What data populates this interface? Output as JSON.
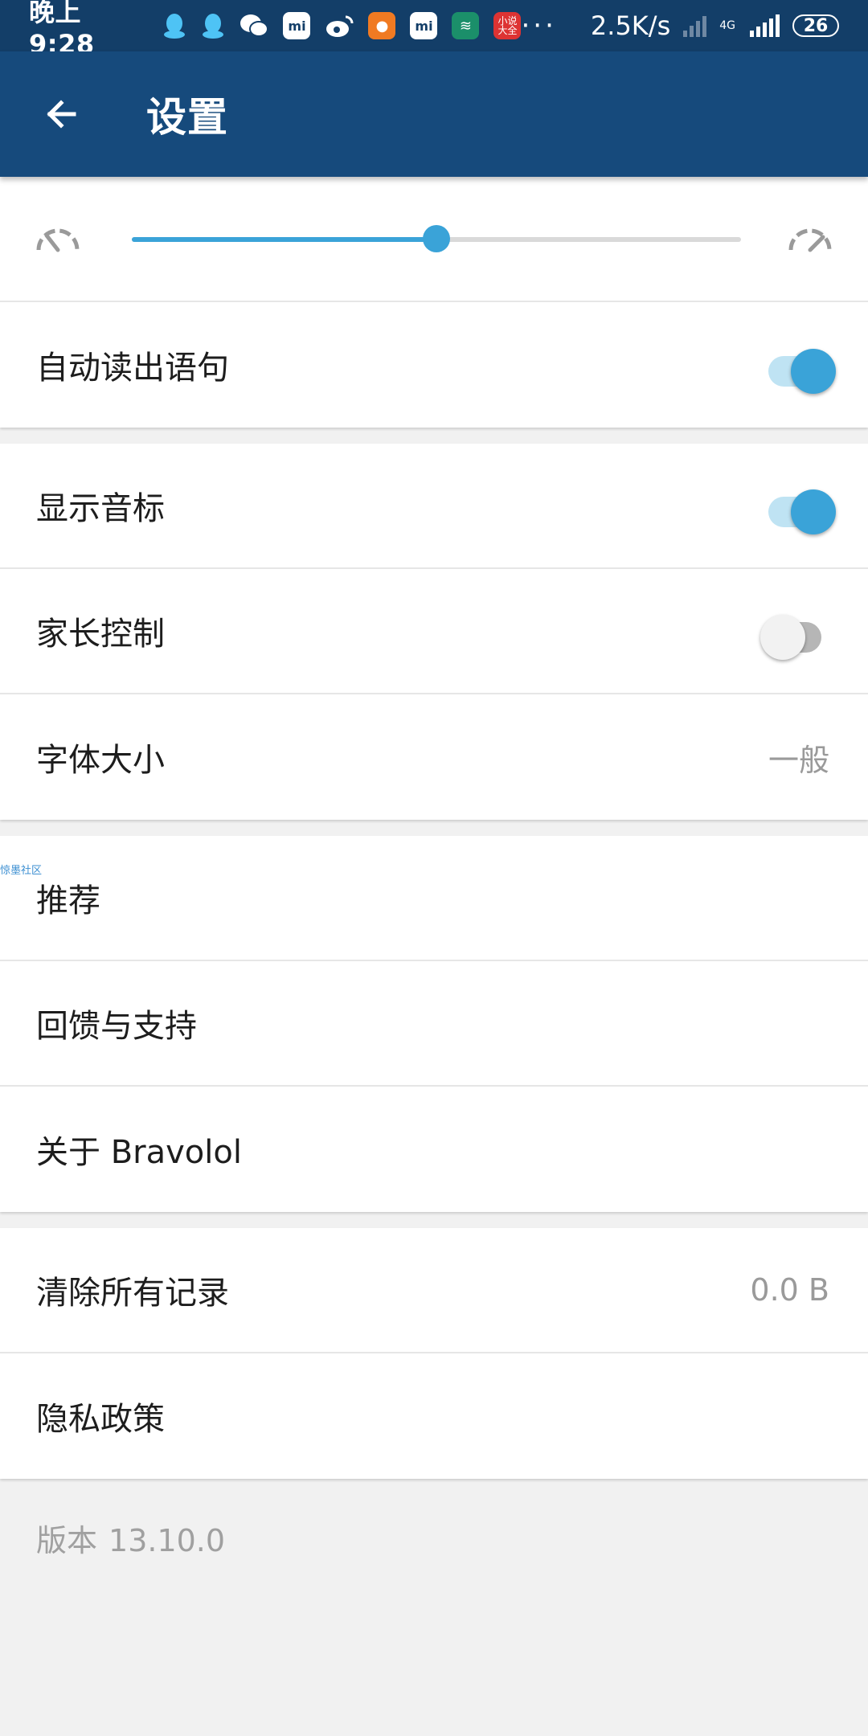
{
  "status_bar": {
    "time": "晚上9:28",
    "icons": [
      "qq-icon",
      "qq-icon",
      "wechat-icon",
      "mi-store-icon",
      "weibo-icon",
      "taobao-icon",
      "mi-store-icon",
      "app-green-icon",
      "novel-app-icon"
    ],
    "mi_label": "mi",
    "novel_label": "小说大全",
    "more": "···",
    "net_speed": "2.5K/s",
    "net_type": "4G",
    "battery": "26"
  },
  "app_bar": {
    "title": "设置"
  },
  "speech_speed": {
    "value_fraction": 0.5,
    "slow_icon": "speedometer-slow-icon",
    "fast_icon": "speedometer-fast-icon"
  },
  "settings": {
    "auto_read": {
      "label": "自动读出语句",
      "on": true
    },
    "show_phonetic": {
      "label": "显示音标",
      "on": true
    },
    "parental_control": {
      "label": "家长控制",
      "on": false
    },
    "font_size": {
      "label": "字体大小",
      "value": "一般"
    },
    "recommend": {
      "label": "推荐"
    },
    "watermark": "惊墨社区",
    "feedback": {
      "label": "回馈与支持"
    },
    "about": {
      "label": "关于 Bravolol"
    },
    "clear_history": {
      "label": "清除所有记录",
      "value": "0.0 B"
    },
    "privacy": {
      "label": "隐私政策"
    }
  },
  "version": {
    "label": "版本",
    "number": "13.10.0"
  },
  "colors": {
    "status_bar": "#133e68",
    "app_bar": "#164a7c",
    "accent": "#3aa3d8"
  }
}
